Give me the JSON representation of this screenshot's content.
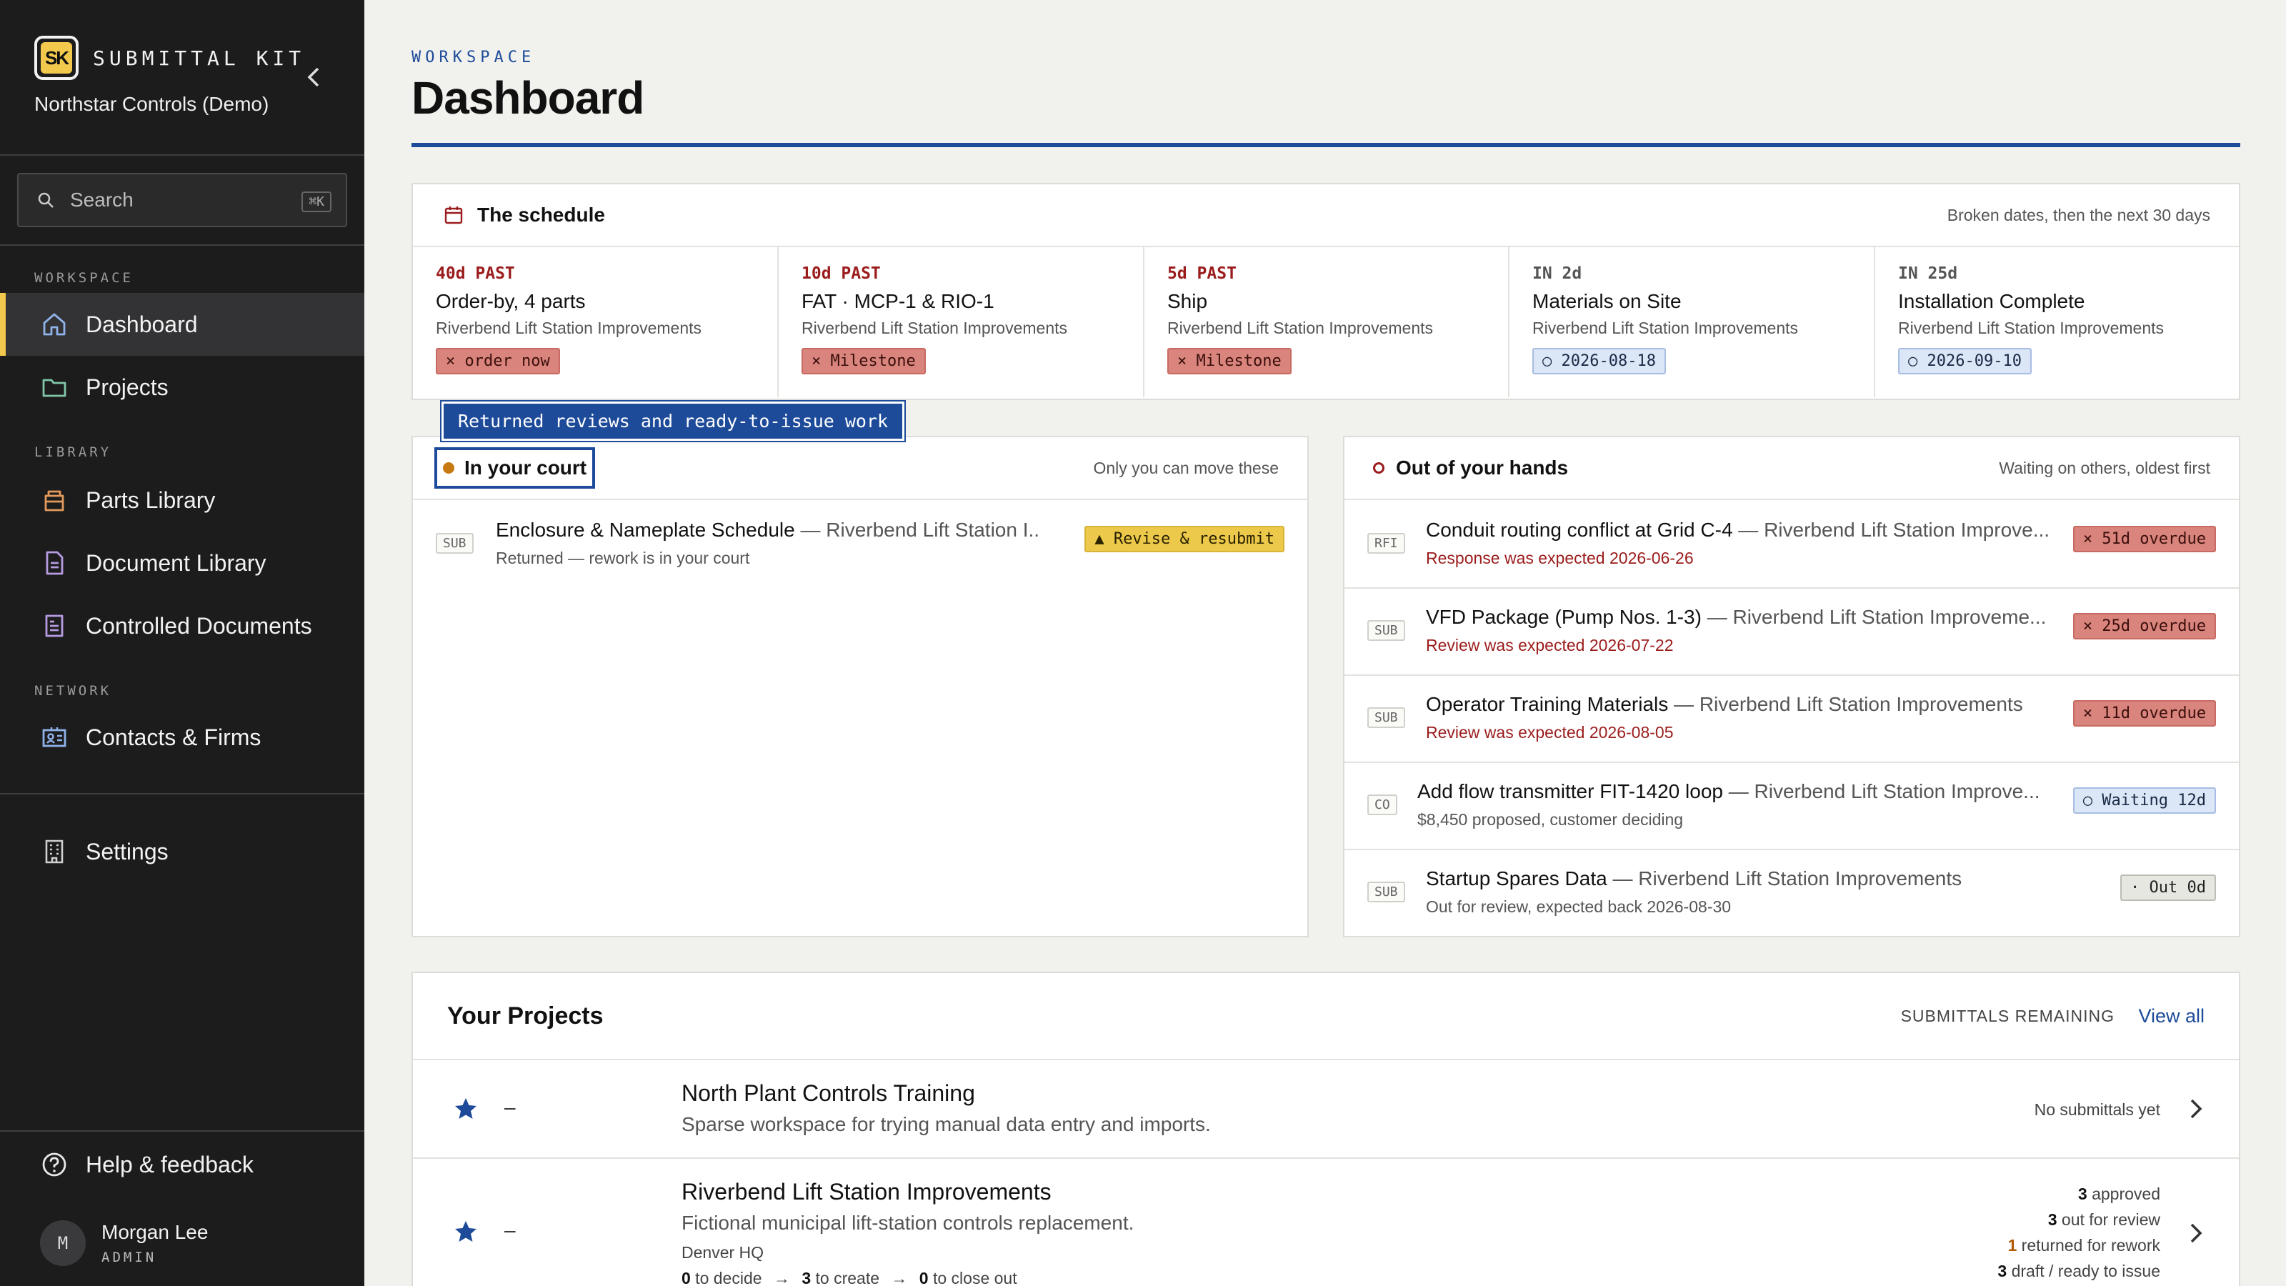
{
  "sidebar": {
    "logo_text": "SK",
    "brand": "SUBMITTAL KIT",
    "org": "Northstar Controls (Demo)",
    "search": {
      "placeholder": "Search",
      "shortcut": "⌘K"
    },
    "sections": {
      "workspace": "WORKSPACE",
      "library": "LIBRARY",
      "network": "NETWORK"
    },
    "items": {
      "dashboard": "Dashboard",
      "projects": "Projects",
      "parts_library": "Parts Library",
      "document_library": "Document Library",
      "controlled_documents": "Controlled Documents",
      "contacts_firms": "Contacts & Firms",
      "settings": "Settings",
      "help": "Help & feedback"
    },
    "user": {
      "initial": "M",
      "name": "Morgan Lee",
      "role": "ADMIN"
    }
  },
  "header": {
    "eyebrow": "WORKSPACE",
    "title": "Dashboard"
  },
  "schedule": {
    "title": "The schedule",
    "note": "Broken dates, then the next 30 days",
    "items": [
      {
        "when": "40d PAST",
        "name": "Order-by, 4 parts",
        "project": "Riverbend Lift Station Improvements",
        "tag": "× order now"
      },
      {
        "when": "10d PAST",
        "name": "FAT · MCP-1 & RIO-1",
        "project": "Riverbend Lift Station Improvements",
        "tag": "× Milestone"
      },
      {
        "when": "5d PAST",
        "name": "Ship",
        "project": "Riverbend Lift Station Improvements",
        "tag": "× Milestone"
      },
      {
        "when": "IN 2d",
        "name": "Materials on Site",
        "project": "Riverbend Lift Station Improvements",
        "tag": "○ 2026-08-18"
      },
      {
        "when": "IN 25d",
        "name": "Installation Complete",
        "project": "Riverbend Lift Station Improvements",
        "tag": "○ 2026-09-10"
      }
    ]
  },
  "tooltip": "Returned reviews and ready-to-issue work",
  "court": {
    "title": "In your court",
    "note": "Only you can move these",
    "items": [
      {
        "kind": "SUB",
        "name": "Enclosure & Nameplate Schedule",
        "project": " — Riverbend Lift Station I...",
        "sub": "Returned — rework is in your court",
        "tag": "▲ Revise & resubmit"
      }
    ]
  },
  "hands": {
    "title": "Out of your hands",
    "note": "Waiting on others, oldest first",
    "items": [
      {
        "kind": "RFI",
        "name": "Conduit routing conflict at Grid C-4",
        "project": " — Riverbend Lift Station Improve...",
        "sub": "Response was expected 2026-06-26",
        "tag": "× 51d overdue"
      },
      {
        "kind": "SUB",
        "name": "VFD Package (Pump Nos. 1-3)",
        "project": " — Riverbend Lift Station Improveme...",
        "sub": "Review was expected 2026-07-22",
        "tag": "× 25d overdue"
      },
      {
        "kind": "SUB",
        "name": "Operator Training Materials",
        "project": " — Riverbend Lift Station Improvements",
        "sub": "Review was expected 2026-08-05",
        "tag": "× 11d overdue"
      },
      {
        "kind": "CO",
        "name": "Add flow transmitter FIT-1420 loop",
        "project": " — Riverbend Lift Station Improve...",
        "sub": "$8,450 proposed, customer deciding",
        "tag": "○ Waiting 12d"
      },
      {
        "kind": "SUB",
        "name": "Startup Spares Data",
        "project": " — Riverbend Lift Station Improvements",
        "sub": "Out for review, expected back 2026-08-30",
        "tag": "· Out 0d"
      }
    ]
  },
  "projects": {
    "title": "Your Projects",
    "remaining_label": "SUBMITTALS REMAINING",
    "view_all": "View all",
    "items": [
      {
        "dash": "–",
        "name": "North Plant Controls Training",
        "desc": "Sparse workspace for trying manual data entry and imports.",
        "status": "No submittals yet"
      },
      {
        "dash": "–",
        "name": "Riverbend Lift Station Improvements",
        "desc": "Fictional municipal lift-station controls replacement.",
        "location": "Denver HQ",
        "flow": {
          "decide_n": "0",
          "decide": " to decide",
          "create_n": "3",
          "create": " to create",
          "close_n": "0",
          "close": " to close out"
        },
        "stats": [
          {
            "n": "3",
            "label": " approved"
          },
          {
            "n": "3",
            "label": " out for review"
          },
          {
            "n": "1",
            "label": " returned for rework"
          },
          {
            "n": "3",
            "label": " draft / ready to issue"
          }
        ]
      }
    ]
  },
  "colors": {
    "accent": "#1d4b9a",
    "brand_yellow": "#f2c94c",
    "danger": "#9b1c1c"
  }
}
